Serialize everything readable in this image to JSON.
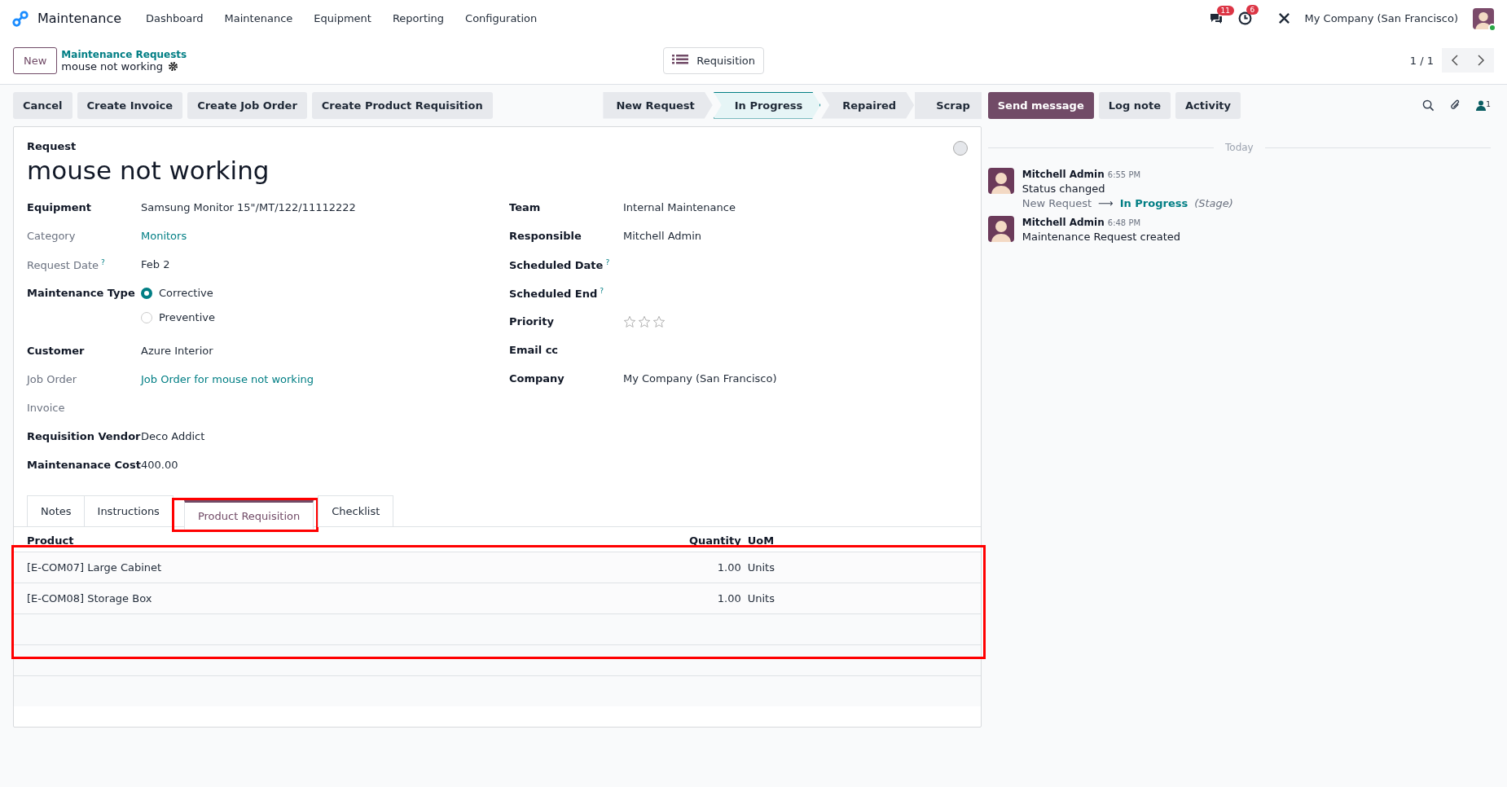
{
  "navbar": {
    "app": "Maintenance",
    "menus": [
      "Dashboard",
      "Maintenance",
      "Equipment",
      "Reporting",
      "Configuration"
    ],
    "messages_badge": "11",
    "activities_badge": "6",
    "company": "My Company (San Francisco)"
  },
  "control_panel": {
    "new_button": "New",
    "breadcrumb": "Maintenance Requests",
    "record": "mouse not working",
    "view_button": "Requisition",
    "pager": "1 / 1"
  },
  "actions": [
    "Cancel",
    "Create Invoice",
    "Create Job Order",
    "Create Product Requisition"
  ],
  "stages": [
    {
      "label": "New Request",
      "selected": false
    },
    {
      "label": "In Progress",
      "selected": true
    },
    {
      "label": "Repaired",
      "selected": false
    },
    {
      "label": "Scrap",
      "selected": false
    }
  ],
  "chatter_buttons": [
    {
      "label": "Send message",
      "kind": "primary"
    },
    {
      "label": "Log note",
      "kind": "secondary"
    },
    {
      "label": "Activity",
      "kind": "secondary"
    }
  ],
  "followers_count": "1",
  "form": {
    "section_label": "Request",
    "title": "mouse not working",
    "left_fields": [
      {
        "label": "Equipment",
        "required": true,
        "kind": "text",
        "value": "Samsung Monitor 15\"/MT/122/11112222"
      },
      {
        "label": "Category",
        "required": false,
        "kind": "link",
        "value": "Monitors"
      },
      {
        "label": "Request Date",
        "required": false,
        "help": "?",
        "kind": "text",
        "value": "Feb 2"
      },
      {
        "label": "Maintenance Type",
        "required": true,
        "kind": "radio",
        "options": [
          {
            "label": "Corrective",
            "selected": true
          },
          {
            "label": "Preventive",
            "selected": false
          }
        ]
      },
      {
        "label": "Customer",
        "required": true,
        "kind": "text",
        "value": "Azure Interior"
      },
      {
        "label": "Job Order",
        "required": false,
        "kind": "link",
        "value": "Job Order for mouse not working"
      },
      {
        "label": "Invoice",
        "required": false,
        "kind": "text"
      },
      {
        "label": "Requisition Vendor",
        "required": true,
        "kind": "text",
        "value": "Deco Addict"
      },
      {
        "label": "Maintenanace Cost",
        "required": true,
        "kind": "text",
        "value": "400.00"
      }
    ],
    "right_fields": [
      {
        "label": "Team",
        "required": true,
        "kind": "text",
        "value": "Internal Maintenance"
      },
      {
        "label": "Responsible",
        "required": true,
        "kind": "text",
        "value": "Mitchell Admin"
      },
      {
        "label": "Scheduled Date",
        "required": true,
        "help": "?",
        "kind": "text"
      },
      {
        "label": "Scheduled End",
        "required": true,
        "help": "?",
        "kind": "text"
      },
      {
        "label": "Priority",
        "required": true,
        "kind": "stars",
        "stars": 0
      },
      {
        "label": "Email cc",
        "required": true,
        "kind": "text"
      },
      {
        "label": "Company",
        "required": true,
        "kind": "text",
        "value": "My Company (San Francisco)"
      }
    ]
  },
  "tabs": [
    {
      "label": "Notes",
      "selected": false,
      "highlighted": false
    },
    {
      "label": "Instructions",
      "selected": false,
      "highlighted": false
    },
    {
      "label": "Product Requisition",
      "selected": true,
      "highlighted": true
    },
    {
      "label": "Checklist",
      "selected": false,
      "highlighted": false
    }
  ],
  "table": {
    "highlighted": true,
    "columns": [
      "Product",
      "Quantity",
      "UoM"
    ],
    "rows": [
      [
        "[E-COM07] Large Cabinet",
        "1.00",
        "Units"
      ],
      [
        "[E-COM08] Storage Box",
        "1.00",
        "Units"
      ]
    ]
  },
  "chatter": {
    "date_separator": "Today",
    "messages": [
      {
        "author": "Mitchell Admin",
        "time": "6:55 PM",
        "body": "Status changed",
        "tracking": {
          "old": "New Request",
          "arrow": "⟶",
          "new": "In Progress",
          "field": "(Stage)"
        }
      },
      {
        "author": "Mitchell Admin",
        "time": "6:48 PM",
        "body": "Maintenance Request created"
      }
    ]
  }
}
